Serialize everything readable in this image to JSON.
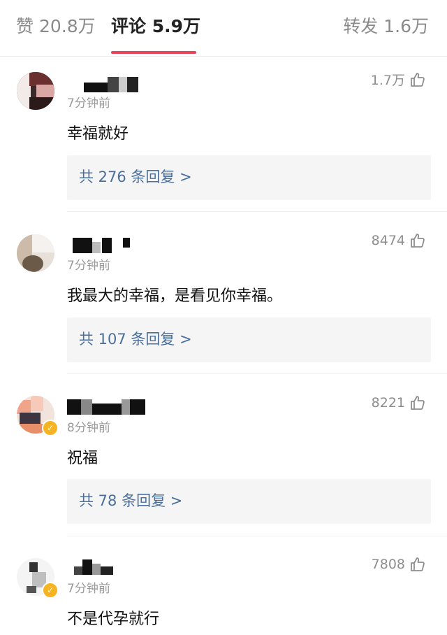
{
  "tabs": {
    "likes": "赞 20.8万",
    "comments": "评论 5.9万",
    "reposts": "转发 1.6万",
    "active_color": "#e8445c"
  },
  "comments": [
    {
      "time": "7分钟前",
      "likes": "1.7万",
      "text": "幸福就好",
      "replies": "共 276 条回复 >"
    },
    {
      "time": "7分钟前",
      "likes": "8474",
      "text": "我最大的幸福，是看见你幸福。",
      "replies": "共 107 条回复 >"
    },
    {
      "time": "8分钟前",
      "likes": "8221",
      "text": "祝福",
      "replies": "共 78 条回复 >"
    },
    {
      "time": "7分钟前",
      "likes": "7808",
      "text": "不是代孕就行"
    }
  ],
  "icons": {
    "like": "thumbs-up-icon",
    "verified": "verified-badge-icon"
  },
  "colors": {
    "reply_link": "#4a6f9c",
    "reply_bg": "#f5f5f5",
    "verified": "#f6b322"
  }
}
